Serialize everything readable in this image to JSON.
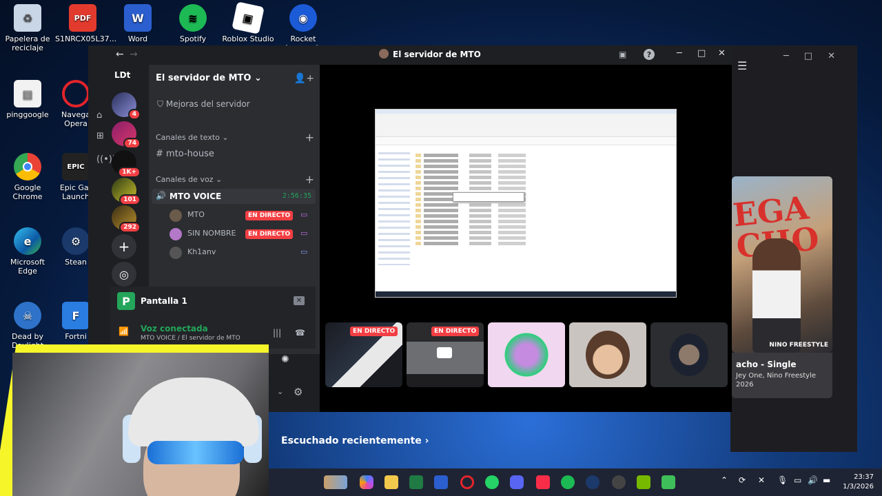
{
  "desktop": {
    "icons": [
      {
        "label": "Papelera de reciclaje",
        "icon": "recycle-bin-icon"
      },
      {
        "label": "S1NRCX05L37...",
        "icon": "pdf-icon"
      },
      {
        "label": "Word",
        "icon": "word-icon"
      },
      {
        "label": "Spotify",
        "icon": "spotify-icon"
      },
      {
        "label": "Roblox Studio",
        "icon": "roblox-icon"
      },
      {
        "label": "Rocket League®",
        "icon": "rocket-league-icon"
      },
      {
        "label": "pinggoogle",
        "icon": "file-icon"
      },
      {
        "label": "Navega Opera",
        "icon": "opera-icon"
      },
      {
        "label": "Google Chrome",
        "icon": "chrome-icon"
      },
      {
        "label": "Epic Gar Launch",
        "icon": "epic-icon"
      },
      {
        "label": "Microsoft Edge",
        "icon": "edge-icon"
      },
      {
        "label": "Stean",
        "icon": "steam-icon"
      },
      {
        "label": "Dead by Daylight",
        "icon": "dbd-icon"
      },
      {
        "label": "Fortni",
        "icon": "fortnite-icon"
      }
    ]
  },
  "music_app": {
    "album_title": "acho - Single",
    "album_artists": "Jey One, Nino Freestyle",
    "album_year": "2026",
    "art_text": "EGA CHO",
    "art_caption": "NINO FREESTYLE",
    "recent_label": "Escuchado recientemente"
  },
  "discord": {
    "window_title": "El servidor de MTO",
    "server_name": "El servidor de MTO",
    "user_tag": "LDt",
    "boost_label": "Mejoras del servidor",
    "text_category": "Canales de texto",
    "text_channel": "mto-house",
    "voice_category": "Canales de voz",
    "voice_channel": "MTO VOICE",
    "voice_time": "2:56:35",
    "guild_badges": [
      "4",
      "74",
      "1K+",
      "101",
      "292"
    ],
    "voice_users": [
      {
        "name": "MTO",
        "live": "EN DIRECTO"
      },
      {
        "name": "SIN NOMBRE",
        "live": "EN DIRECTO"
      },
      {
        "name": "Kh1anv",
        "live": ""
      }
    ],
    "screen_panel_label": "Pantalla 1",
    "connection_status": "Voz conectada",
    "connection_detail": "MTO VOICE / El servidor de MTO",
    "stream_thumbs": [
      {
        "live": "EN DIRECTO"
      },
      {
        "live": "EN DIRECTO"
      },
      {
        "live": ""
      },
      {
        "live": ""
      },
      {
        "live": ""
      }
    ]
  },
  "taskbar": {
    "time": "23:37",
    "date": "1/3/2026"
  }
}
